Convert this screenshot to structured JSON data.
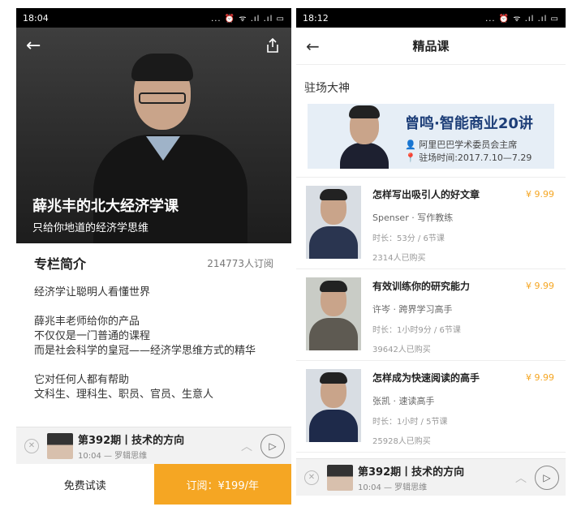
{
  "left": {
    "status": {
      "time": "18:04",
      "icons": "... ⏰ ᯤ .ıl .ıl ▭"
    },
    "hero": {
      "title": "薛兆丰的北大经济学课",
      "subtitle": "只给你地道的经济学思维"
    },
    "intro": {
      "heading": "专栏简介",
      "subscribers": "214773人订阅",
      "paragraphs": [
        "经济学让聪明人看懂世界",
        "薛兆丰老师给你的产品",
        "不仅仅是一门普通的课程",
        "而是社会科学的皇冠——经济学思维方式的精华",
        "它对任何人都有帮助",
        "文科生、理科生、职员、官员、生意人"
      ]
    },
    "player": {
      "title": "第392期丨技术的方向",
      "sub": "10:04 — 罗辑思维"
    },
    "actions": {
      "trial": "免费试读",
      "buy": "订阅：¥199/年"
    }
  },
  "right": {
    "status": {
      "time": "18:12",
      "icons": "... ⏰ ᯤ .ıl .ıl ▭"
    },
    "nav": {
      "title": "精品课"
    },
    "section": "驻场大神",
    "banner": {
      "title": "曾鸣·智能商业20讲",
      "line1": "阿里巴巴学术委员会主席",
      "line2": "驻场时间:2017.7.10—7.29"
    },
    "courses": [
      {
        "title": "怎样写出吸引人的好文章",
        "author": "Spenser · 写作教练",
        "duration": "时长：53分 / 6节课",
        "buyers": "2314人已购买",
        "price": "¥ 9.99"
      },
      {
        "title": "有效训练你的研究能力",
        "author": "许岑 · 跨界学习高手",
        "duration": "时长：1小时9分 / 6节课",
        "buyers": "39642人已购买",
        "price": "¥ 9.99"
      },
      {
        "title": "怎样成为快速阅读的高手",
        "author": "张凯 · 速读高手",
        "duration": "时长：1小时 / 5节课",
        "buyers": "25928人已购买",
        "price": "¥ 9.99"
      }
    ],
    "player": {
      "title": "第392期丨技术的方向",
      "sub": "10:04 — 罗辑思维"
    }
  }
}
